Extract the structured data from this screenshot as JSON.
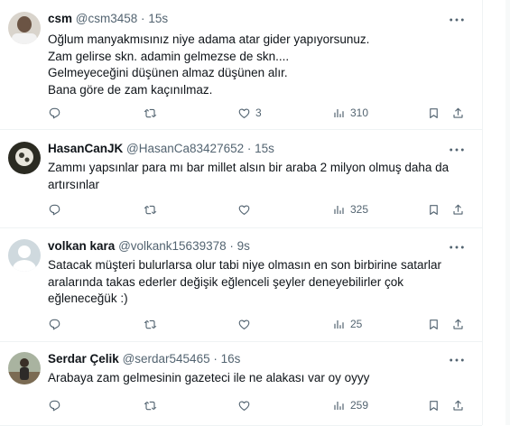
{
  "tweets": [
    {
      "name": "csm",
      "handle": "@csm3458",
      "dot": "·",
      "time": "15s",
      "text": "Oğlum manyakmısınız niye adama atar gider yapıyorsunuz.\nZam gelirse skn. adamin gelmezse de skn....\nGelmeyeceğini düşünen almaz düşünen alır.\nBana göre de zam kaçınılmaz.",
      "replies": "",
      "retweets": "",
      "likes": "3",
      "views": "310"
    },
    {
      "name": "HasanCanJK",
      "handle": "@HasanCa83427652",
      "dot": "·",
      "time": "15s",
      "text": "Zammı yapsınlar para mı bar millet alsın bir araba 2 milyon olmuş daha da artırsınlar",
      "replies": "",
      "retweets": "",
      "likes": "",
      "views": "325"
    },
    {
      "name": "volkan kara",
      "handle": "@volkank15639378",
      "dot": "·",
      "time": "9s",
      "text": "Satacak müşteri bulurlarsa olur tabi niye olmasın en son birbirine satarlar aralarında takas ederler değişik eğlenceli şeyler deneyebilirler çok eğleneceğük :)",
      "replies": "",
      "retweets": "",
      "likes": "",
      "views": "25"
    },
    {
      "name": "Serdar Çelik",
      "handle": "@serdar545465",
      "dot": "·",
      "time": "16s",
      "text": "Arabaya zam gelmesinin gazeteci ile ne alakası var  oy oyyy",
      "replies": "",
      "retweets": "",
      "likes": "",
      "views": "259"
    }
  ],
  "icons": {
    "reply": "reply-icon",
    "retweet": "retweet-icon",
    "like": "heart-icon",
    "views": "views-icon",
    "bookmark": "bookmark-icon",
    "share": "share-icon",
    "more": "more-icon"
  },
  "colors": {
    "text": "#0f1419",
    "secondary": "#536471",
    "divider": "#eff3f4"
  }
}
